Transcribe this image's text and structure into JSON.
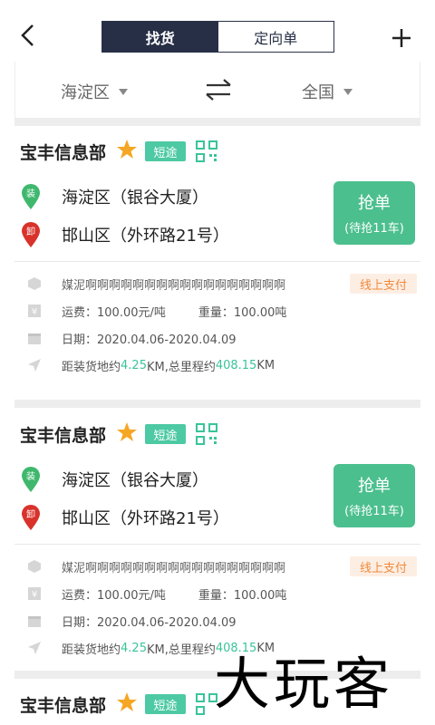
{
  "header": {
    "tabs": [
      {
        "label": "找货",
        "active": true
      },
      {
        "label": "定向单",
        "active": false
      }
    ],
    "back_icon": "chevron-left-icon",
    "add_icon": "plus-icon"
  },
  "filter": {
    "from": "海淀区",
    "to": "全国",
    "swap_icon": "swap-arrows-icon"
  },
  "cards": [
    {
      "company": "宝丰信息部",
      "tag": "短途",
      "load_badge": "装",
      "unload_badge": "卸",
      "load_place": "海淀区（银谷大厦）",
      "unload_place": "邯山区（外环路21号）",
      "grab_title": "抢单",
      "grab_sub": "(待抢11车)",
      "goods": "媒泥啊啊啊啊啊啊啊啊啊啊啊啊啊啊啊啊啊",
      "pay": "线上支付",
      "freight": "运费：100.00元/吨",
      "weight": "重量：100.00吨",
      "date": "日期：2020.04.06-2020.04.09",
      "dist_prefix": "距装货地约",
      "dist_value": "4.25",
      "dist_mid": "KM,总里程约",
      "total_value": "408.15",
      "dist_suffix": "KM"
    },
    {
      "company": "宝丰信息部",
      "tag": "短途",
      "load_badge": "装",
      "unload_badge": "卸",
      "load_place": "海淀区（银谷大厦）",
      "unload_place": "邯山区（外环路21号）",
      "grab_title": "抢单",
      "grab_sub": "(待抢11车)",
      "goods": "媒泥啊啊啊啊啊啊啊啊啊啊啊啊啊啊啊啊啊",
      "pay": "线上支付",
      "freight": "运费：100.00元/吨",
      "weight": "重量：100.00吨",
      "date": "日期：2020.04.06-2020.04.09",
      "dist_prefix": "距装货地约",
      "dist_value": "4.25",
      "dist_mid": "KM,总里程约",
      "total_value": "408.15",
      "dist_suffix": "KM"
    },
    {
      "company": "宝丰信息部",
      "tag": "短途"
    }
  ],
  "colors": {
    "accent_green": "#4cbf8e",
    "tag_green": "#4dc9a3",
    "nav_dark": "#262f45",
    "pay_orange": "#f08a3c",
    "star_orange": "#f5a623",
    "load_pin": "#3fb86e",
    "unload_pin": "#d9322b"
  },
  "watermark": "大玩客"
}
